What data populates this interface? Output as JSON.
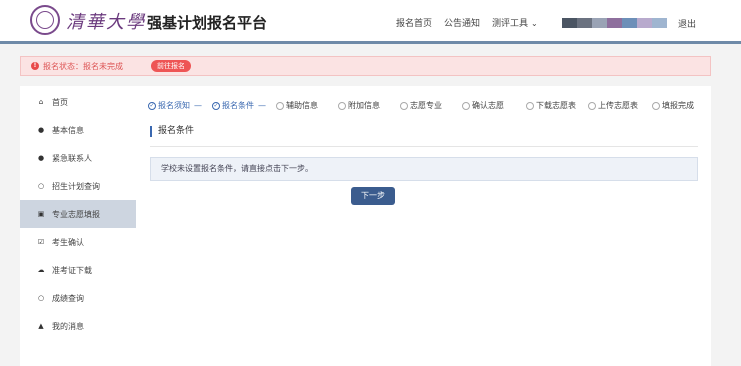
{
  "header": {
    "university_name": "清華大學",
    "platform_title": "强基计划报名平台",
    "nav": [
      {
        "label": "报名首页"
      },
      {
        "label": "公告通知"
      },
      {
        "label": "测评工具"
      }
    ],
    "logout_label": "退出",
    "user_name_bar_colors": [
      "#4b5563",
      "#6b7280",
      "#9aa3b5",
      "#8e6f9d",
      "#6d8fb8",
      "#b8aacd",
      "#9fb5d0"
    ],
    "accent_color": "#6e8aa8"
  },
  "alert": {
    "status_text": "报名状态：报名未完成",
    "action_label": "前往报名",
    "color": "#e55555"
  },
  "sidebar": {
    "items": [
      {
        "label": "首页",
        "icon": "home-icon"
      },
      {
        "label": "基本信息",
        "icon": "user-icon"
      },
      {
        "label": "紧急联系人",
        "icon": "user-icon"
      },
      {
        "label": "招生计划查询",
        "icon": "search-icon"
      },
      {
        "label": "专业志愿填报",
        "icon": "form-icon",
        "active": true
      },
      {
        "label": "考生确认",
        "icon": "check-icon"
      },
      {
        "label": "准考证下载",
        "icon": "cloud-download-icon"
      },
      {
        "label": "成绩查询",
        "icon": "search-icon"
      },
      {
        "label": "我的消息",
        "icon": "bell-icon"
      }
    ]
  },
  "steps": [
    {
      "label": "报名须知",
      "done": true
    },
    {
      "label": "报名条件",
      "done": true
    },
    {
      "label": "辅助信息",
      "done": false
    },
    {
      "label": "附加信息",
      "done": false
    },
    {
      "label": "志愿专业",
      "done": false
    },
    {
      "label": "确认志愿",
      "done": false
    },
    {
      "label": "下载志愿表",
      "done": false
    },
    {
      "label": "上传志愿表",
      "done": false
    },
    {
      "label": "填报完成",
      "done": false
    }
  ],
  "main": {
    "section_title": "报名条件",
    "info_text": "学校未设置报名条件，请直接点击下一步。",
    "next_button": "下一步"
  }
}
